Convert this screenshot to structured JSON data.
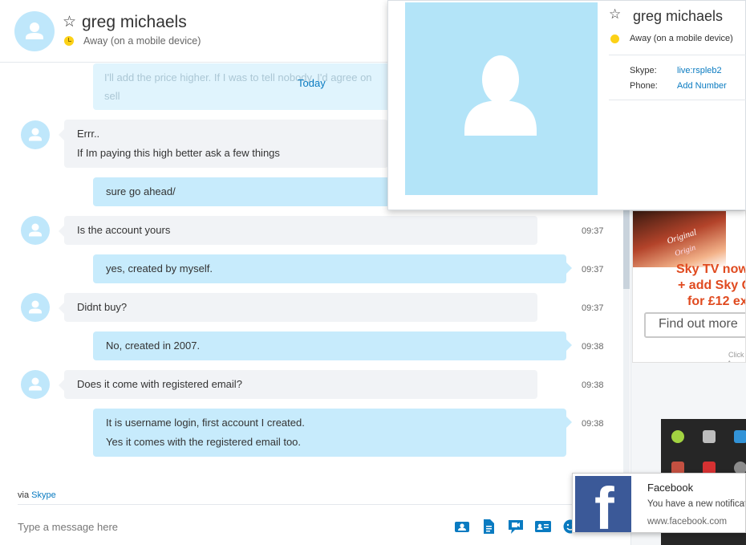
{
  "header": {
    "contact_name": "greg michaels",
    "status": "Away (on a mobile device)",
    "status_color": "#fcd116"
  },
  "conversation": {
    "faded_line1": "I'll add the price higher. If I was to tell nobody, I'd agree on",
    "faded_line2": "sell",
    "day_separator": "Today",
    "messages": [
      {
        "direction": "incoming",
        "lines": [
          "Errr..",
          "If Im paying this high better ask a few things"
        ],
        "time": ""
      },
      {
        "direction": "outgoing",
        "lines": [
          "sure go ahead/"
        ],
        "time": ""
      },
      {
        "direction": "incoming",
        "lines": [
          "Is the account yours"
        ],
        "time": "09:37"
      },
      {
        "direction": "outgoing",
        "lines": [
          "yes, created by myself."
        ],
        "time": "09:37"
      },
      {
        "direction": "incoming",
        "lines": [
          "Didnt buy?"
        ],
        "time": "09:37"
      },
      {
        "direction": "outgoing",
        "lines": [
          "No, created in 2007."
        ],
        "time": "09:38"
      },
      {
        "direction": "incoming",
        "lines": [
          "Does it come with registered email?"
        ],
        "time": "09:38"
      },
      {
        "direction": "outgoing",
        "lines": [
          "It is username login, first account I created.",
          "Yes it comes with the registered email too."
        ],
        "time": "09:38"
      }
    ]
  },
  "footer": {
    "via_prefix": "via",
    "via_link": "Skype",
    "input_placeholder": "Type a message here",
    "tools": [
      "send-contact-icon",
      "send-file-icon",
      "video-message-icon",
      "contact-card-icon",
      "emoticon-icon"
    ]
  },
  "profile_card": {
    "name": "greg michaels",
    "status": "Away (on a mobile device)",
    "skype_label": "Skype:",
    "skype_value": "live:rspleb2",
    "phone_label": "Phone:",
    "phone_value": "Add Number"
  },
  "ad": {
    "box_text": "Original",
    "box_text2": "Origin",
    "line1": "Sky TV now",
    "line2": "+ add Sky Q",
    "line3": "for £12 ex",
    "button": "Find out more",
    "footer": "Click t"
  },
  "toast": {
    "title": "Facebook",
    "body": "You have a new notificat",
    "url": "www.facebook.com"
  },
  "colors": {
    "accent": "#0a7bc1",
    "incoming_bubble": "#f1f3f6",
    "outgoing_bubble": "#c7ebfc",
    "facebook": "#3b5998"
  }
}
